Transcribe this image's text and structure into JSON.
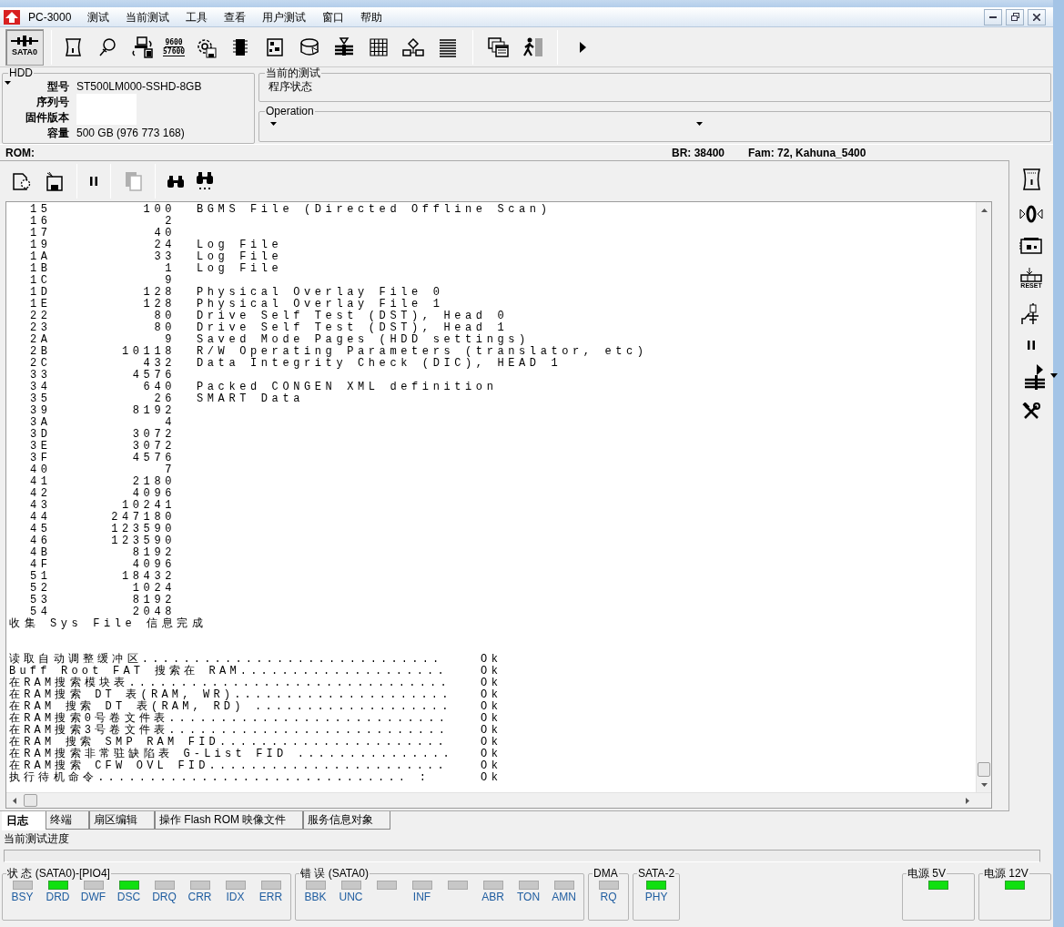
{
  "menu": {
    "app": "PC-3000",
    "items": [
      "测试",
      "当前测试",
      "工具",
      "查看",
      "用户测试",
      "窗口",
      "帮助"
    ]
  },
  "toolbar": {
    "port_button": {
      "label": "SATA0",
      "pressed": true
    },
    "baud_labels": [
      "9600",
      "57600"
    ]
  },
  "hdd": {
    "title": "HDD",
    "fields": [
      {
        "label": "型号",
        "value": "ST500LM000-SSHD-8GB",
        "redacted": false
      },
      {
        "label": "序列号",
        "redacted": true
      },
      {
        "label": "固件版本",
        "redacted": true
      },
      {
        "label": "容量",
        "value": "500 GB (976 773 168)",
        "redacted": false
      }
    ]
  },
  "current_test": {
    "title": "当前的测试",
    "value": "程序状态"
  },
  "operation": {
    "title": "Operation"
  },
  "info_bar": {
    "rom": "ROM:",
    "br": "BR: 38400",
    "fam": "Fam: 72, Kahuna_5400"
  },
  "log_toolbar": {
    "copy_disabled": true
  },
  "log": {
    "rows": [
      {
        "id": "15",
        "size": "100",
        "description": "BGMS File (Directed Offline Scan)"
      },
      {
        "id": "16",
        "size": "2"
      },
      {
        "id": "17",
        "size": "40"
      },
      {
        "id": "19",
        "size": "24",
        "description": "Log File"
      },
      {
        "id": "1A",
        "size": "33",
        "description": "Log File"
      },
      {
        "id": "1B",
        "size": "1",
        "description": "Log File"
      },
      {
        "id": "1C",
        "size": "9"
      },
      {
        "id": "1D",
        "size": "128",
        "description": "Physical Overlay File 0"
      },
      {
        "id": "1E",
        "size": "128",
        "description": "Physical Overlay File 1"
      },
      {
        "id": "22",
        "size": "80",
        "description": "Drive Self Test (DST), Head 0"
      },
      {
        "id": "23",
        "size": "80",
        "description": "Drive Self Test (DST), Head 1"
      },
      {
        "id": "2A",
        "size": "9",
        "description": "Saved Mode Pages (HDD settings)"
      },
      {
        "id": "2B",
        "size": "10118",
        "description": "R/W Operating Parameters (translator, etc)"
      },
      {
        "id": "2C",
        "size": "432",
        "description": "Data Integrity Check (DIC), HEAD 1"
      },
      {
        "id": "33",
        "size": "4576"
      },
      {
        "id": "34",
        "size": "640",
        "description": "Packed CONGEN XML definition"
      },
      {
        "id": "35",
        "size": "26",
        "description": "SMART Data"
      },
      {
        "id": "39",
        "size": "8192"
      },
      {
        "id": "3A",
        "size": "4"
      },
      {
        "id": "3D",
        "size": "3072"
      },
      {
        "id": "3E",
        "size": "3072"
      },
      {
        "id": "3F",
        "size": "4576"
      },
      {
        "id": "40",
        "size": "7"
      },
      {
        "id": "41",
        "size": "2180"
      },
      {
        "id": "42",
        "size": "4096"
      },
      {
        "id": "43",
        "size": "10241"
      },
      {
        "id": "44",
        "size": "247180"
      },
      {
        "id": "45",
        "size": "123590"
      },
      {
        "id": "46",
        "size": "123590"
      },
      {
        "id": "4B",
        "size": "8192"
      },
      {
        "id": "4F",
        "size": "4096"
      },
      {
        "id": "51",
        "size": "18432"
      },
      {
        "id": "52",
        "size": "1024"
      },
      {
        "id": "53",
        "size": "8192"
      },
      {
        "id": "54",
        "size": "2048"
      }
    ],
    "summary": "收集 Sys File 信息完成",
    "checks": [
      {
        "text": "读取自动调整缓冲区.............................",
        "result": "Ok"
      },
      {
        "text": "Buff Root FAT 搜索在 RAM....................",
        "result": "Ok"
      },
      {
        "text": "在RAM搜索模块表...............................",
        "result": "Ok"
      },
      {
        "text": "在RAM搜索 DT 表(RAM, WR).....................",
        "result": "Ok"
      },
      {
        "text": "在RAM 搜索 DT 表(RAM, RD) ...................",
        "result": "Ok"
      },
      {
        "text": "在RAM搜索0号卷文件表...........................",
        "result": "Ok"
      },
      {
        "text": "在RAM搜索3号卷文件表...........................",
        "result": "Ok"
      },
      {
        "text": "在RAM 搜索 SMP RAM FID......................",
        "result": "Ok"
      },
      {
        "text": "在RAM搜索非常驻缺陷表 G-List FID ...............",
        "result": "Ok"
      },
      {
        "text": "在RAM搜索 CFW OVL FID.......................",
        "result": "Ok"
      },
      {
        "text": "执行待机命令.............................. :",
        "result": "Ok"
      }
    ]
  },
  "sidebar": {
    "reset_label": "RESET"
  },
  "tabs": [
    {
      "label": "日志",
      "selected": true
    },
    {
      "label": "终端",
      "selected": false
    },
    {
      "label": "扇区编辑",
      "selected": false
    },
    {
      "label": "操作 Flash ROM 映像文件",
      "selected": false
    },
    {
      "label": "服务信息对象",
      "selected": false
    }
  ],
  "progress": {
    "label": "当前测试进度",
    "level": 0
  },
  "status_groups": [
    {
      "title": "状 态 (SATA0)-[PIO4]",
      "leds": [
        {
          "label": "BSY",
          "on": false
        },
        {
          "label": "DRD",
          "on": true
        },
        {
          "label": "DWF",
          "on": false
        },
        {
          "label": "DSC",
          "on": true
        },
        {
          "label": "DRQ",
          "on": false
        },
        {
          "label": "CRR",
          "on": false
        },
        {
          "label": "IDX",
          "on": false
        },
        {
          "label": "ERR",
          "on": false
        }
      ]
    },
    {
      "title": "错 误 (SATA0)",
      "leds": [
        {
          "label": "BBK",
          "on": false
        },
        {
          "label": "UNC",
          "on": false
        },
        {
          "on": false
        },
        {
          "label": "INF",
          "on": false
        },
        {
          "on": false
        },
        {
          "label": "ABR",
          "on": false
        },
        {
          "label": "TON",
          "on": false
        },
        {
          "label": "AMN",
          "on": false
        }
      ]
    },
    {
      "title": "DMA",
      "leds": [
        {
          "label": "RQ",
          "on": false
        }
      ]
    },
    {
      "title": "SATA-2",
      "leds": [
        {
          "label": "PHY",
          "on": true
        }
      ]
    },
    {
      "title": "电源 5V",
      "leds": [
        {
          "on": true
        }
      ]
    },
    {
      "title": "电源 12V",
      "leds": [
        {
          "on": true
        }
      ]
    }
  ]
}
